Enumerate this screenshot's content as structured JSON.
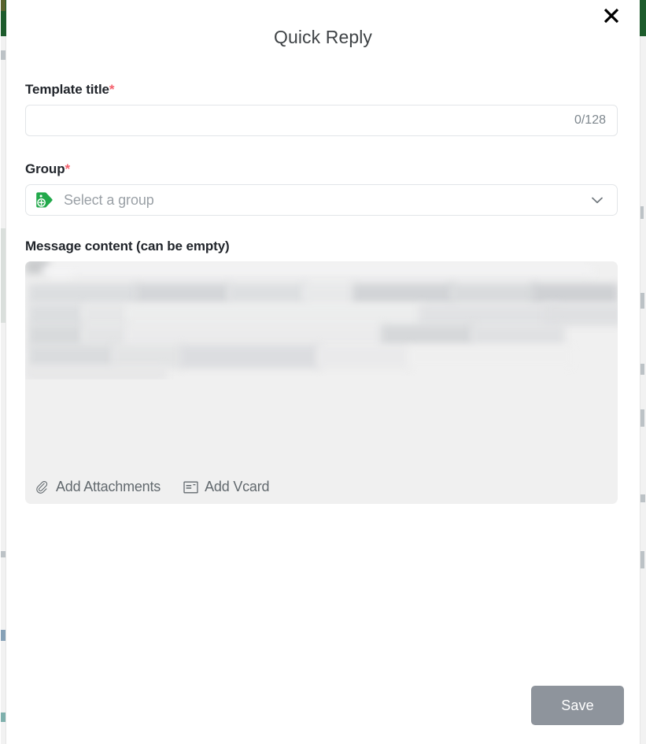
{
  "modal": {
    "title": "Quick Reply",
    "close_label": "×",
    "close_icon": "close-icon"
  },
  "form": {
    "template_title": {
      "label": "Template title",
      "required_mark": "*",
      "value": "",
      "placeholder": "",
      "counter": "0/128",
      "max_length": 128
    },
    "group": {
      "label": "Group",
      "required_mark": "*",
      "selected": "",
      "placeholder": "Select a group",
      "icon": "tag-plus-icon",
      "chevron_icon": "chevron-down-icon"
    },
    "message_content": {
      "label": "Message content (can be empty)",
      "value": "",
      "redacted": true,
      "toolbar": [
        {
          "label": "Add Attachments",
          "icon": "paperclip-icon"
        },
        {
          "label": "Add Vcard",
          "icon": "vcard-icon"
        }
      ]
    }
  },
  "footer": {
    "save_label": "Save",
    "save_enabled": false
  },
  "colors": {
    "accent_green": "#22a94b",
    "required_red": "#f4606c",
    "save_disabled": "#8e949c",
    "field_border": "#e2e5e8",
    "content_bg": "#f0f0f0",
    "background_topbar": "#1d5c2c"
  }
}
